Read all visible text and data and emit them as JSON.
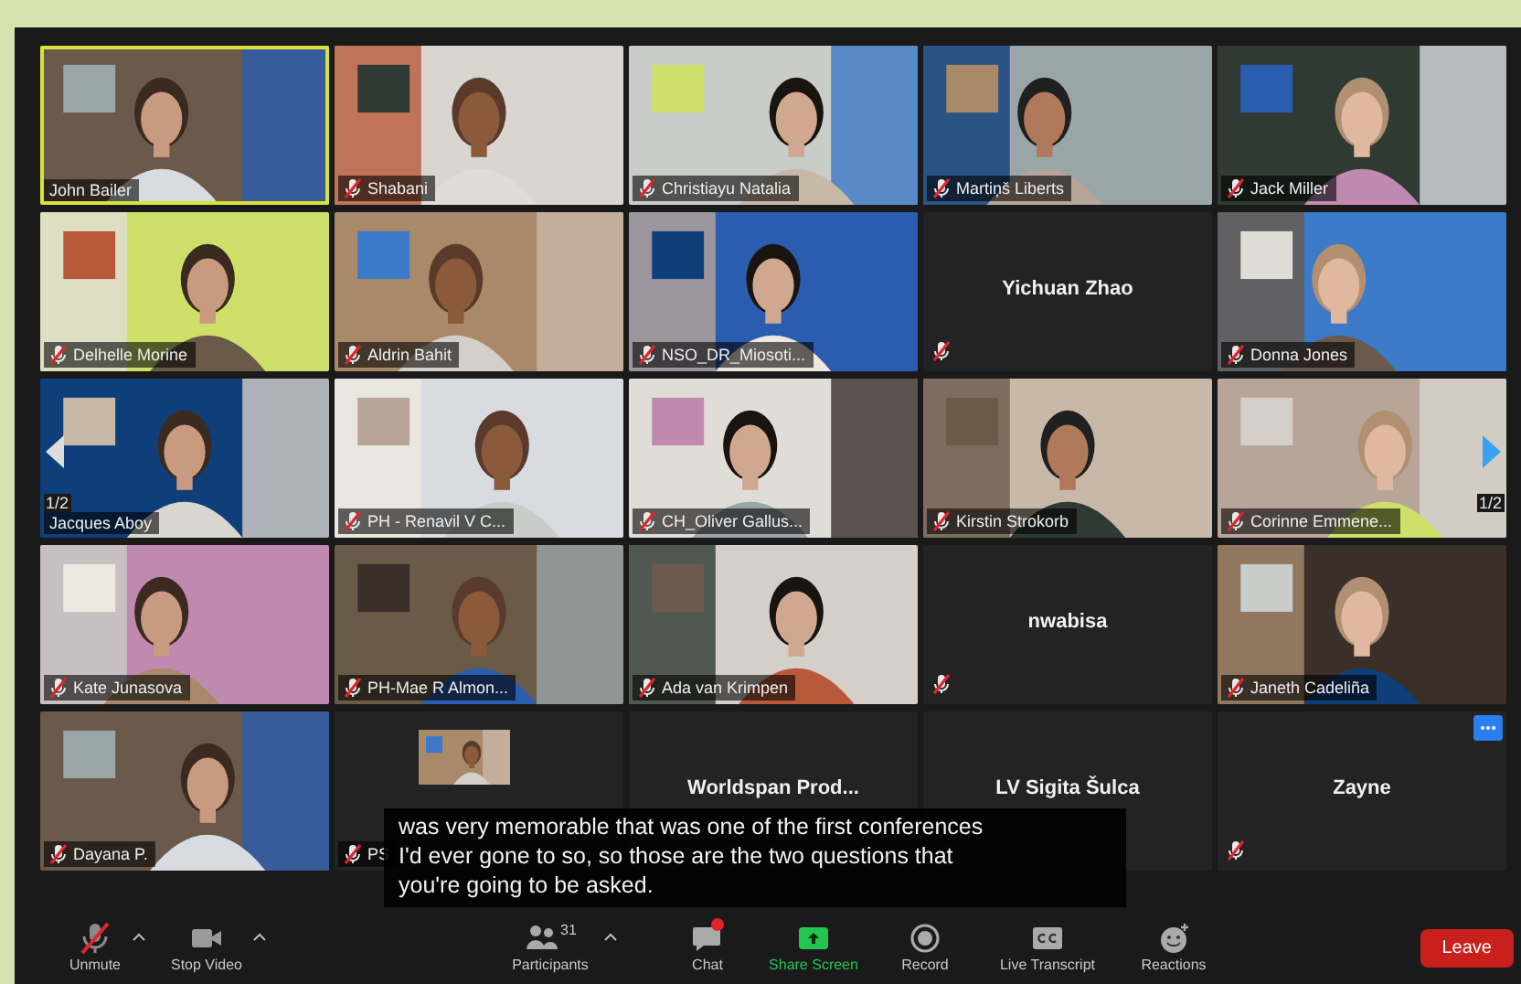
{
  "pager": {
    "left": "1/2",
    "right": "1/2"
  },
  "tiles": [
    {
      "name": "John Bailer",
      "kind": "video",
      "muted": false,
      "speaking": true,
      "hovered": false
    },
    {
      "name": "Shabani",
      "kind": "video",
      "muted": true,
      "speaking": false,
      "hovered": false
    },
    {
      "name": "Christiayu Natalia",
      "kind": "video",
      "muted": true,
      "speaking": false,
      "hovered": false
    },
    {
      "name": "Martiņš Liberts",
      "kind": "video",
      "muted": true,
      "speaking": false,
      "hovered": false
    },
    {
      "name": "Jack Miller",
      "kind": "video",
      "muted": true,
      "speaking": false,
      "hovered": false
    },
    {
      "name": "Delhelle Morine",
      "kind": "video",
      "muted": true,
      "speaking": false,
      "hovered": false
    },
    {
      "name": "Aldrin Bahit",
      "kind": "video",
      "muted": true,
      "speaking": false,
      "hovered": false
    },
    {
      "name": "NSO_DR_Miosoti...",
      "kind": "video",
      "muted": true,
      "speaking": false,
      "hovered": false
    },
    {
      "name": "Yichuan Zhao",
      "kind": "name",
      "muted": true,
      "speaking": false,
      "hovered": false
    },
    {
      "name": "Donna Jones",
      "kind": "video",
      "muted": true,
      "speaking": false,
      "hovered": false
    },
    {
      "name": "Jacques Aboy",
      "kind": "video",
      "muted": false,
      "speaking": false,
      "hovered": false
    },
    {
      "name": "PH - Renavil V C...",
      "kind": "video",
      "muted": true,
      "speaking": false,
      "hovered": false
    },
    {
      "name": "CH_Oliver Gallus...",
      "kind": "video",
      "muted": true,
      "speaking": false,
      "hovered": false
    },
    {
      "name": "Kirstin Strokorb",
      "kind": "video",
      "muted": true,
      "speaking": false,
      "hovered": false
    },
    {
      "name": "Corinne Emmene...",
      "kind": "video",
      "muted": true,
      "speaking": false,
      "hovered": false
    },
    {
      "name": "Kate Junasova",
      "kind": "video",
      "muted": true,
      "speaking": false,
      "hovered": false
    },
    {
      "name": "PH-Mae R Almon...",
      "kind": "video",
      "muted": true,
      "speaking": false,
      "hovered": false
    },
    {
      "name": "Ada van Krimpen",
      "kind": "video",
      "muted": true,
      "speaking": false,
      "hovered": false
    },
    {
      "name": "nwabisa",
      "kind": "name",
      "muted": true,
      "speaking": false,
      "hovered": false
    },
    {
      "name": "Janeth Cadeliña",
      "kind": "video",
      "muted": true,
      "speaking": false,
      "hovered": false
    },
    {
      "name": "Dayana P.",
      "kind": "video",
      "muted": true,
      "speaking": false,
      "hovered": false
    },
    {
      "name": "PS",
      "kind": "thumb",
      "muted": true,
      "speaking": false,
      "hovered": false
    },
    {
      "name": "Worldspan  Prod...",
      "kind": "name",
      "muted": false,
      "speaking": false,
      "hovered": false
    },
    {
      "name": "LV Sigita Šulca",
      "kind": "name",
      "muted": false,
      "speaking": false,
      "hovered": false
    },
    {
      "name": "Zayne",
      "kind": "name",
      "muted": true,
      "speaking": false,
      "hovered": true
    }
  ],
  "captions": [
    "was very memorable that was one of the first conferences",
    "I'd ever gone to so, so those are the two questions that",
    "you're going to be asked."
  ],
  "toolbar_left": [
    {
      "label": "Unmute",
      "kind": "mic",
      "caret": true,
      "notification": false
    },
    {
      "label": "Stop Video",
      "kind": "camera",
      "caret": true,
      "notification": false
    }
  ],
  "toolbar_center": [
    {
      "label": "Participants",
      "kind": "people",
      "caret": true,
      "count": "31",
      "notification": false
    },
    {
      "label": "Chat",
      "kind": "chat",
      "caret": false,
      "notification": true
    },
    {
      "label": "Share Screen",
      "kind": "share",
      "caret": false,
      "notification": false
    },
    {
      "label": "Record",
      "kind": "record",
      "caret": false,
      "notification": false
    },
    {
      "label": "Live Transcript",
      "kind": "cc",
      "caret": false,
      "notification": false
    },
    {
      "label": "Reactions",
      "kind": "smile",
      "caret": false,
      "notification": false
    }
  ],
  "leave": "Leave"
}
